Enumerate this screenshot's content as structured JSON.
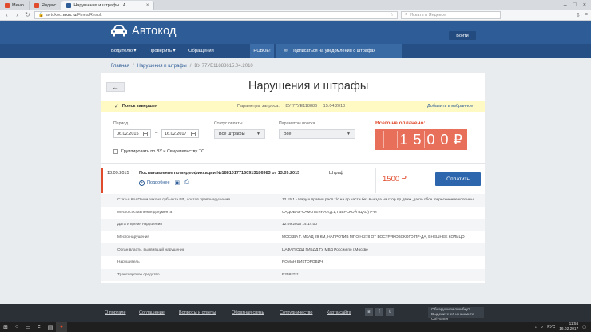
{
  "browser": {
    "tabs": [
      {
        "label": "Меню",
        "color": "#e04b2d"
      },
      {
        "label": "Яндекс",
        "color": "#e04b2d"
      },
      {
        "label": "Нарушения и штрафы | А...",
        "color": "#2d5c96"
      }
    ],
    "url_prefix": "avtokod.",
    "url_host": "mos.ru",
    "url_path": "/Fines/Result",
    "search_placeholder": "Искать в Яндексе"
  },
  "header": {
    "logo_text": "Автокод",
    "login_label": "Войти",
    "nav": {
      "driver": "Водителю ▾",
      "check": "Проверить ▾",
      "requests": "Обращения"
    },
    "new_badge": "НОВОЕ!",
    "subscribe": "Подписаться на уведомления о штрафах"
  },
  "breadcrumb": {
    "home": "Главная",
    "sep": "/",
    "section": "Нарушения и штрафы",
    "current": "ВУ 77УЕ11888615.04.2010"
  },
  "page": {
    "title": "Нарушения и штрафы",
    "back_icon": "←"
  },
  "status": {
    "done": "Поиск завершен",
    "params_label": "Параметры запроса:",
    "params_doc": "ВУ 77УЕ118886",
    "params_date": "15.04.2010",
    "favorite": "Добавить в избранное"
  },
  "filters": {
    "period_label": "Период",
    "date_from": "06.02.2015",
    "date_to": "16.02.2017",
    "dash": "–",
    "pay_status_label": "Статус оплаты",
    "pay_status_value": "Все штрафы",
    "search_params_label": "Параметры поиска",
    "search_params_value": "Все",
    "group_label": "Группировать по ВУ и Свидетельству ТС"
  },
  "total": {
    "label": "Всего не оплачено:",
    "digits": [
      "",
      "1",
      "5",
      "0",
      "0"
    ],
    "currency": "₽"
  },
  "fine": {
    "date": "13.09.2015",
    "title": "Постановление по видеофиксации №18810177150913186983 от 13.09.2015",
    "details_link": "Подробнее",
    "type": "Штраф",
    "sum": "1500 ₽",
    "pay_label": "Оплатить",
    "rows": [
      {
        "label": "Статья КоАП или закона субъекта РФ, состав правонарушения",
        "value": "12.15.1 - Наруш.правил расп.т/с на пр.части без выезда на стор.пр.движ.,да по обоч.,пересечение колонны"
      },
      {
        "label": "Место составления документа",
        "value": "САДОВАЯ-САМОТЕЧНАЯ,д.1,ТВЕРСКОЙ (ЦАО) Р-Н"
      },
      {
        "label": "Дата и время нарушения",
        "value": "12.09.2015 14:14:00"
      },
      {
        "label": "Место нарушения",
        "value": "МОСКВА Г. МКАД 29 КМ, НАПРОТИВ МПО Н 278 ОТ ВОСТРЯКОВСКОГО ПР-ДА, ВНЕШНЕЕ КОЛЬЦО"
      },
      {
        "label": "Орган власти, выявивший нарушение",
        "value": "ЦАФАП ОДД ГИБДД ГУ МВД России по г.Москве"
      },
      {
        "label": "Нарушитель",
        "value": "РОМАН ВИКТОРОВИЧ"
      },
      {
        "label": "Транспортное средство",
        "value": "Р258*****"
      }
    ]
  },
  "footer": {
    "links": [
      "О портале",
      "Соглашение",
      "Вопросы и ответы",
      "Обратная связь",
      "Сотрудничество",
      "Карта сайта"
    ],
    "error_title": "Обнаружили ошибку?",
    "error_hint": "Выделите её и нажмите Ctrl+Enter"
  },
  "taskbar": {
    "lang": "РУС",
    "time": "11:56",
    "date": "16.02.2017"
  },
  "colors": {
    "brand": "#2d5c96",
    "accent": "#e04b2d",
    "status_bg": "#fff9c4"
  }
}
